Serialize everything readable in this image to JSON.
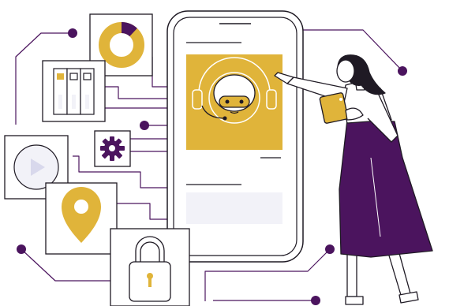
{
  "colors": {
    "accent": "#E0B43A",
    "accent_dark": "#B8901E",
    "purple": "#4B145E",
    "outline": "#1F1A24",
    "line": "#4B145E",
    "panel": "#F2F2F8",
    "bg": "#FFFFFF"
  },
  "icons": [
    "donut-chart-icon",
    "file-cabinet-icon",
    "gear-icon",
    "video-play-icon",
    "location-pin-icon",
    "padlock-icon",
    "robot-chatbot-icon",
    "tablet-icon"
  ],
  "chart": {
    "donut_fraction": 0.12
  }
}
